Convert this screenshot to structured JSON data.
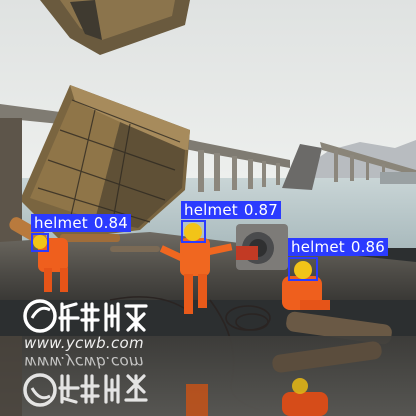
{
  "colors": {
    "box": "#2b3bff",
    "label_bg": "#2b3bff",
    "label_text": "#ffffff",
    "sky": "#e6e8e6",
    "water": "#c2cfd1",
    "deck": "#595650",
    "vest": "#f0641e",
    "hardhat": "#f2c418"
  },
  "detections": [
    {
      "label": "helmet",
      "score": "0.84"
    },
    {
      "label": "helmet",
      "score": "0.87"
    },
    {
      "label": "helmet",
      "score": "0.86"
    }
  ],
  "watermark": {
    "site": "www.ycwb.com",
    "site_mirror": "www.ycwb.com"
  }
}
